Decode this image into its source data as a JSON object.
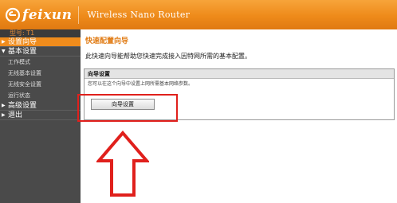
{
  "header": {
    "brand": "feixun",
    "title": "Wireless Nano Router",
    "brand_color": "#ee8a1a"
  },
  "sidebar": {
    "model_label": "型号: T1",
    "items": [
      {
        "label": "设置向导",
        "type": "group",
        "active": true
      },
      {
        "label": "基本设置",
        "type": "group",
        "active": false
      },
      {
        "label": "工作模式",
        "type": "sub"
      },
      {
        "label": "无线基本设置",
        "type": "sub"
      },
      {
        "label": "无线安全设置",
        "type": "sub"
      },
      {
        "label": "运行状态",
        "type": "sub"
      },
      {
        "label": "高级设置",
        "type": "group",
        "active": false
      },
      {
        "label": "退出",
        "type": "group",
        "active": false
      }
    ]
  },
  "main": {
    "title": "快速配置向导",
    "description": "此快速向导能帮助您快速完成接入因特网所需的基本配置。",
    "panel": {
      "header": "向导设置",
      "text": "您可以在这个向导中设置上网所需基本网络参数。",
      "button_label": "向导设置"
    }
  },
  "annotations": {
    "highlight_color": "#e0201c",
    "arrow_icon": "arrow-up-outline-icon"
  }
}
